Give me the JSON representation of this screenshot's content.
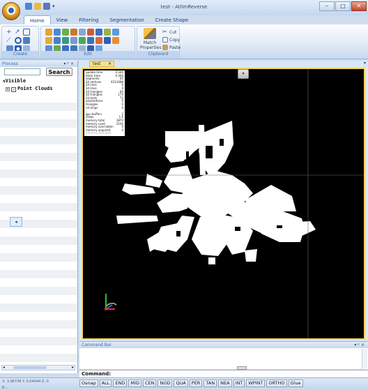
{
  "window": {
    "title": "test - AtlimReverse"
  },
  "ribbon": {
    "tabs": [
      "Home",
      "View",
      "Filtering",
      "Segmentation",
      "Create Shape"
    ],
    "active_tab": "Home",
    "groups": {
      "create": "Create",
      "edit": "Edit",
      "clipboard": "Clipboard"
    },
    "match_properties": "Match Properties",
    "cut": "Cut",
    "copy": "Copy",
    "paste": "Paste"
  },
  "process_panel": {
    "title": "Process",
    "search_button": "Search",
    "search_placeholder": "",
    "visible_label": "Visible",
    "tree_item": "Point Clouds"
  },
  "viewport": {
    "tab_label": "test",
    "stats": [
      {
        "k": "update time",
        "v": "0.344"
      },
      {
        "k": "block time",
        "v": "0.300"
      },
      {
        "k": "segments",
        "v": "45"
      },
      {
        "k": "3d vertices",
        "v": "4213488"
      },
      {
        "k": "2d lines",
        "v": "0"
      },
      {
        "k": "3d lines",
        "v": "0"
      },
      {
        "k": "2d triangles",
        "v": "66"
      },
      {
        "k": "3d triangles",
        "v": "174"
      },
      {
        "k": "2d texts",
        "v": "73"
      },
      {
        "k": "polyhedrons",
        "v": "0"
      },
      {
        "k": "triangles",
        "v": "0"
      },
      {
        "k": "nd strips",
        "v": "0"
      },
      {
        "k": "...",
        "v": "",
        "dim": true
      },
      {
        "k": "gpu buffers",
        "v": "1"
      },
      {
        "k": "views",
        "v": "1 6"
      },
      {
        "k": "memory total",
        "v": "3870"
      },
      {
        "k": "memory used",
        "v": "2100"
      },
      {
        "k": "memory overridden",
        "v": "0"
      },
      {
        "k": "memory acquired",
        "v": "0"
      },
      {
        "k": "memory allocated",
        "v": "",
        "dim": true
      }
    ]
  },
  "command_bar": {
    "title": "Command Bar",
    "prompt": "Command:"
  },
  "status": {
    "coords": "X: 3.98738  Y: 0.04044  Z: 0",
    "ready": "R...",
    "snaps": [
      "Osnap",
      "ALL",
      "END",
      "MID",
      "CEN",
      "NOD",
      "QUA",
      "PER",
      "TAN",
      "NEA",
      "INT",
      "WPINT",
      "ORTHO",
      "Glue"
    ]
  }
}
